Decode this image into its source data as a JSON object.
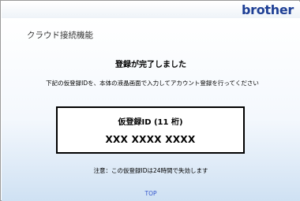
{
  "header": {
    "brand": "brother"
  },
  "main": {
    "page_title": "クラウド接続機能",
    "headline": "登録が完了しました",
    "instruction": "下記の仮登録IDを、本体の液晶画面で入力してアカウント登録を行ってください",
    "id_box": {
      "label": "仮登録ID (11 桁)",
      "value": "XXX XXXX XXXX"
    },
    "notice": "注意：この仮登録IDは24時間で失効します",
    "top_link": "TOP"
  },
  "colors": {
    "brand": "#1e3f95",
    "link": "#3355cc",
    "background_gradient_end": "#cfe1f3"
  }
}
